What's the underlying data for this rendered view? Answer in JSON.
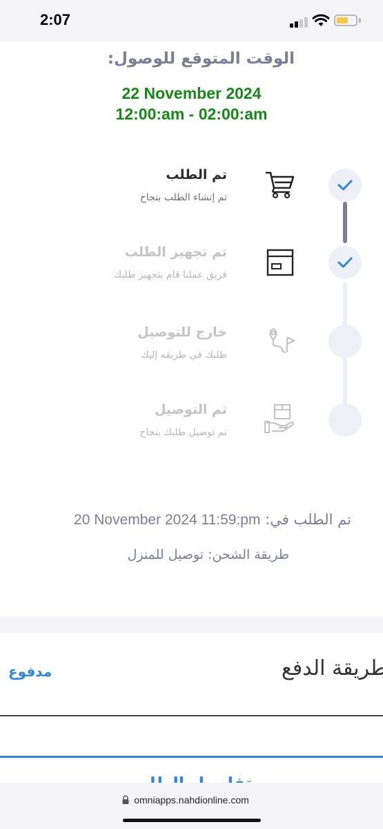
{
  "status_bar": {
    "time": "2:07"
  },
  "eta": {
    "label": "الوقت المتوقع للوصول:",
    "date": "22 November 2024",
    "time_range": "12:00:am - 02:00:am"
  },
  "steps": [
    {
      "title": "تم الطلب",
      "subtitle": "تم إنشاء الطلب بنجاح",
      "completed": true,
      "icon": "cart-icon"
    },
    {
      "title": "تم تجهيز الطلب",
      "subtitle": "فريق عملنا قام بتجهيز طلبك",
      "completed": true,
      "icon": "box-window-icon"
    },
    {
      "title": "خارج للتوصيل",
      "subtitle": "طلبك في طريقه إليك",
      "completed": false,
      "icon": "route-pin-icon"
    },
    {
      "title": "تم التوصيل",
      "subtitle": "تم توصيل طلبك بنجاح",
      "completed": false,
      "icon": "hand-box-icon"
    }
  ],
  "order_info": {
    "order_date_label": "تم الطلب في:",
    "order_date_value": "20 November 2024 11:59:pm",
    "shipping_label": "طريقة الشحن:",
    "shipping_value": "توصيل للمنزل"
  },
  "payment": {
    "title": "طريقة الدفع",
    "status": "مدفوع"
  },
  "tabs": {
    "details": "تفاصيل الطلب"
  },
  "browser": {
    "url": "omniapps.nahdionline.com"
  },
  "colors": {
    "accent_green": "#148a14",
    "muted_purple": "#7c7d99",
    "link_blue": "#2d87e0",
    "check_blue": "#2d87e0"
  }
}
